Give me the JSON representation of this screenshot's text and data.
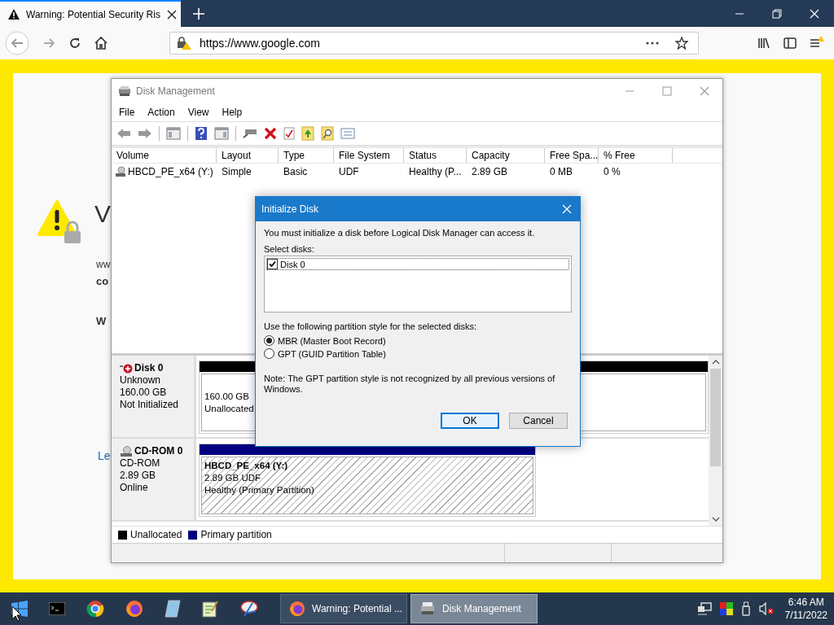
{
  "browser": {
    "tab_title": "Warning: Potential Security Ris",
    "address": "https://www.google.com",
    "page_fragments": [
      {
        "kind": "heading",
        "text": "V"
      },
      {
        "kind": "text",
        "text": "ww"
      },
      {
        "kind": "bold",
        "text": "co"
      },
      {
        "kind": "bold",
        "text": "W"
      },
      {
        "kind": "link",
        "text": "Le"
      }
    ]
  },
  "disk_management": {
    "title": "Disk Management",
    "menu": [
      "File",
      "Action",
      "View",
      "Help"
    ],
    "columns": [
      "Volume",
      "Layout",
      "Type",
      "File System",
      "Status",
      "Capacity",
      "Free Spa...",
      "% Free"
    ],
    "volumes": [
      {
        "cells": [
          "HBCD_PE_x64 (Y:)",
          "Simple",
          "Basic",
          "UDF",
          "Healthy (P...",
          "2.89 GB",
          "0 MB",
          "0 %"
        ]
      }
    ],
    "disks": [
      {
        "kind": "disk",
        "name": "Disk 0",
        "type": "Unknown",
        "size": "160.00 GB",
        "status": "Not Initialized",
        "partitions": [
          {
            "kind": "unallocated",
            "lines": [
              "160.00 GB",
              "Unallocated"
            ]
          }
        ]
      },
      {
        "kind": "cdrom",
        "name": "CD-ROM 0",
        "type": "CD-ROM",
        "size": "2.89 GB",
        "status": "Online",
        "partitions": [
          {
            "kind": "primary",
            "name": "HBCD_PE_x64  (Y:)",
            "lines": [
              "2.89 GB UDF",
              "Healthy (Primary Partition)"
            ]
          }
        ]
      }
    ],
    "legend": [
      {
        "label": "Unallocated",
        "color": "#000000"
      },
      {
        "label": "Primary partition",
        "color": "#000080"
      }
    ]
  },
  "dialog": {
    "title": "Initialize Disk",
    "message": "You must initialize a disk before Logical Disk Manager can access it.",
    "select_label": "Select disks:",
    "disks": [
      {
        "label": "Disk 0",
        "checked": true,
        "selected": true
      }
    ],
    "style_label": "Use the following partition style for the selected disks:",
    "styles": [
      {
        "label": "MBR (Master Boot Record)",
        "selected": true
      },
      {
        "label": "GPT (GUID Partition Table)",
        "selected": false
      }
    ],
    "note": "Note: The GPT partition style is not recognized by all previous versions of Windows.",
    "buttons": [
      {
        "label": "OK",
        "default": true
      },
      {
        "label": "Cancel",
        "default": false
      }
    ]
  },
  "taskbar": {
    "windows": [
      {
        "label": "Warning: Potential ...",
        "selected": false,
        "kind": "firefox"
      },
      {
        "label": "Disk Management",
        "selected": true,
        "kind": "disk"
      }
    ],
    "time": "6:46 AM",
    "date": "7/11/2022"
  }
}
